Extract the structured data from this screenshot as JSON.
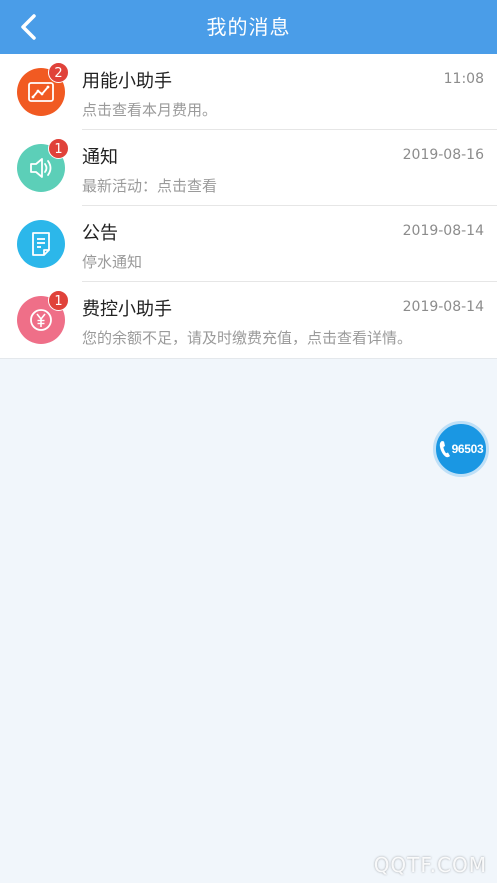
{
  "header": {
    "title": "我的消息"
  },
  "messages": [
    {
      "title": "用能小助手",
      "time": "11:08",
      "subtitle": "点击查看本月费用。",
      "badge": "2",
      "icon": "chart-icon",
      "color": "#f15a22"
    },
    {
      "title": "通知",
      "time": "2019-08-16",
      "subtitle": "最新活动：点击查看",
      "badge": "1",
      "icon": "speaker-icon",
      "color": "#5ccfb8"
    },
    {
      "title": "公告",
      "time": "2019-08-14",
      "subtitle": "停水通知",
      "badge": "",
      "icon": "document-icon",
      "color": "#2cb7ea"
    },
    {
      "title": "费控小助手",
      "time": "2019-08-14",
      "subtitle": "您的余额不足，请及时缴费充值，点击查看详情。",
      "badge": "1",
      "icon": "yen-icon",
      "color": "#ef6f88"
    }
  ],
  "hotline": {
    "number": "96503",
    "icon": "phone-icon"
  },
  "watermark": "QQTF.COM"
}
